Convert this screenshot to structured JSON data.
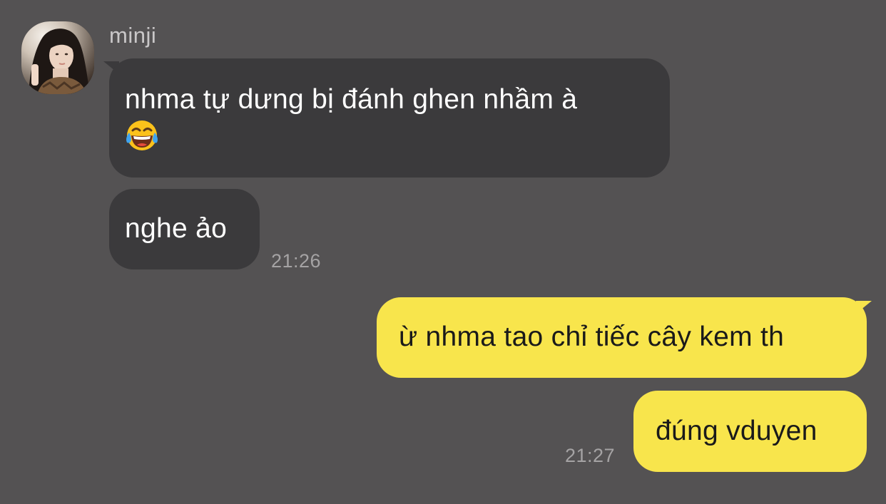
{
  "conversation": {
    "sender": {
      "name": "minji",
      "avatar_icon": "profile-photo"
    },
    "incoming": [
      {
        "text": "nhma tự dưng bị đánh ghen nhầm à",
        "emoji": "face-with-tears-of-joy"
      },
      {
        "text": "nghe ảo"
      }
    ],
    "incoming_time": "21:26",
    "outgoing": [
      {
        "text": "ừ nhma tao chỉ tiếc cây kem th"
      },
      {
        "text": "đúng vduyen"
      }
    ],
    "outgoing_time": "21:27"
  },
  "theme": {
    "background": "#545253",
    "incoming_bubble": "#3b3a3c",
    "outgoing_bubble": "#f8e54c",
    "timestamp_color": "#a5a3a4"
  }
}
